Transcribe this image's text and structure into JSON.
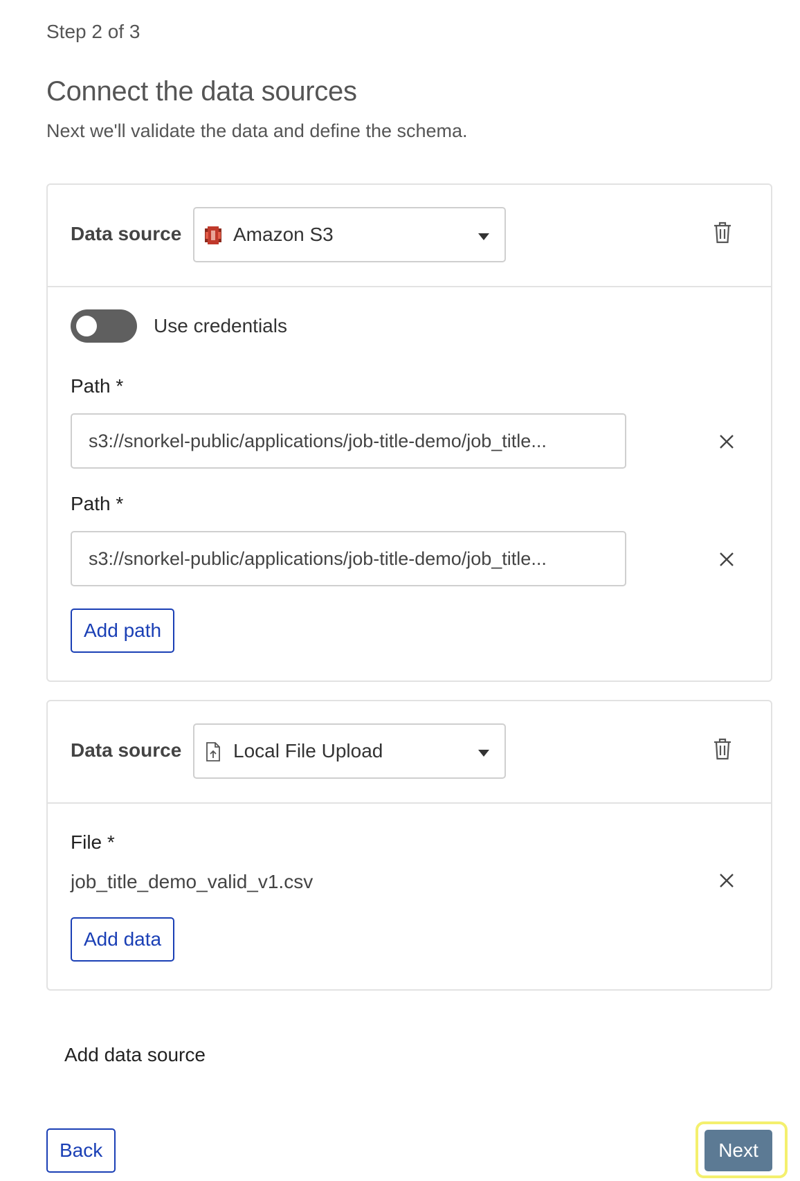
{
  "header": {
    "step": "Step 2 of 3",
    "title": "Connect the data sources",
    "subtitle": "Next we'll validate the data and define the schema."
  },
  "sources": [
    {
      "label": "Data source",
      "selected": "Amazon S3",
      "icon": "amazon-s3-icon",
      "use_credentials_label": "Use credentials",
      "use_credentials_on": false,
      "paths": [
        {
          "label": "Path *",
          "value": "s3://snorkel-public/applications/job-title-demo/job_title..."
        },
        {
          "label": "Path *",
          "value": "s3://snorkel-public/applications/job-title-demo/job_title..."
        }
      ],
      "add_label": "Add path"
    },
    {
      "label": "Data source",
      "selected": "Local File Upload",
      "icon": "file-upload-icon",
      "file_label": "File *",
      "file_name": "job_title_demo_valid_v1.csv",
      "add_label": "Add data"
    }
  ],
  "add_source_label": "Add data source",
  "footer": {
    "back_label": "Back",
    "next_label": "Next"
  },
  "colors": {
    "primary": "#1a3fb5",
    "next_bg": "#5c7a94",
    "highlight": "#f4f06e",
    "s3_icon": "#c0392b"
  }
}
